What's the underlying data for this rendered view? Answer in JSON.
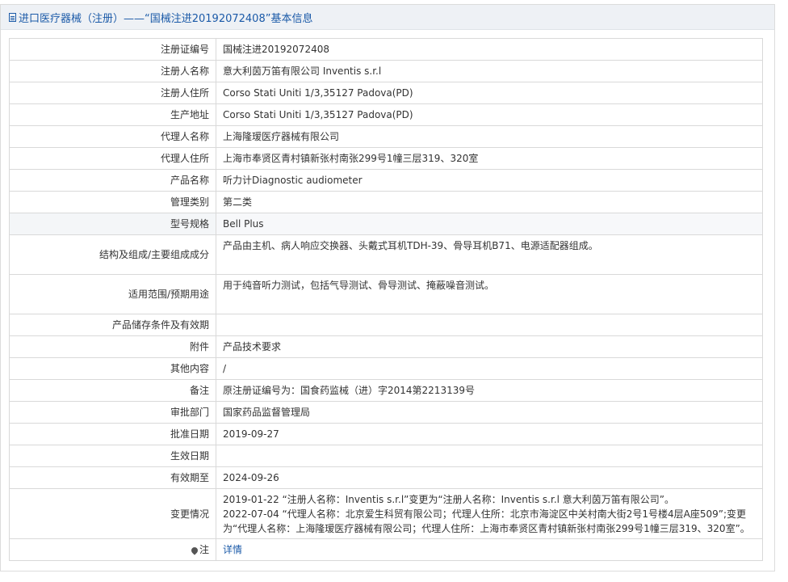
{
  "header": {
    "icon": "document-icon",
    "title": "进口医疗器械（注册）——“国械注进20192072408”基本信息"
  },
  "rows": [
    {
      "label": "注册证编号",
      "value": "国械注进20192072408"
    },
    {
      "label": "注册人名称",
      "value": "意大利茵万笛有限公司 Inventis s.r.l"
    },
    {
      "label": "注册人住所",
      "value": "Corso Stati Uniti 1/3,35127 Padova(PD)"
    },
    {
      "label": "生产地址",
      "value": "Corso Stati Uniti 1/3,35127 Padova(PD)"
    },
    {
      "label": "代理人名称",
      "value": "上海隆瑷医疗器械有限公司"
    },
    {
      "label": "代理人住所",
      "value": "上海市奉贤区青村镇新张村南张299号1幢三层319、320室"
    },
    {
      "label": "产品名称",
      "value": "听力计Diagnostic audiometer"
    },
    {
      "label": "管理类别",
      "value": "第二类"
    },
    {
      "label": "型号规格",
      "value": "Bell Plus"
    },
    {
      "label": "结构及组成/主要组成成分",
      "value": "产品由主机、病人响应交换器、头戴式耳机TDH-39、骨导耳机B71、电源适配器组成。"
    },
    {
      "label": "适用范围/预期用途",
      "value": "用于纯音听力测试，包括气导测试、骨导测试、掩蔽噪音测试。"
    },
    {
      "label": "产品储存条件及有效期",
      "value": ""
    },
    {
      "label": "附件",
      "value": "产品技术要求"
    },
    {
      "label": "其他内容",
      "value": "/"
    },
    {
      "label": "备注",
      "value": "原注册证编号为：国食药监械（进）字2014第2213139号"
    },
    {
      "label": "审批部门",
      "value": "国家药品监督管理局"
    },
    {
      "label": "批准日期",
      "value": "2019-09-27"
    },
    {
      "label": "生效日期",
      "value": ""
    },
    {
      "label": "有效期至",
      "value": "2024-09-26"
    },
    {
      "label": "变更情况",
      "lines": [
        "2019-01-22 “注册人名称：Inventis s.r.l”变更为“注册人名称：Inventis s.r.l 意大利茵万笛有限公司”。",
        "2022-07-04 “代理人名称：北京爱生科贸有限公司；代理人住所：北京市海淀区中关村南大街2号1号楼4层A座509”;变更为“代理人名称：上海隆瑷医疗器械有限公司；代理人住所：上海市奉贤区青村镇新张村南张299号1幢三层319、320室”。"
      ]
    },
    {
      "label": "注",
      "icon": "pin-icon",
      "link": "详情"
    }
  ]
}
